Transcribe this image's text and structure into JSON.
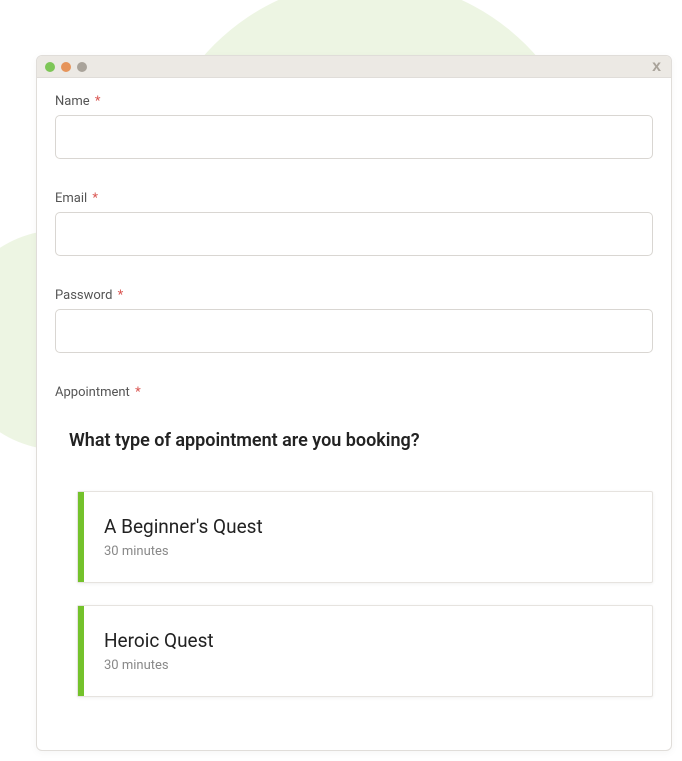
{
  "fields": {
    "name": {
      "label": "Name",
      "value": ""
    },
    "email": {
      "label": "Email",
      "value": ""
    },
    "password": {
      "label": "Password",
      "value": ""
    },
    "appointment": {
      "label": "Appointment"
    }
  },
  "required_marker": "*",
  "appointment_section": {
    "heading": "What type of appointment are you booking?",
    "options": [
      {
        "title": "A Beginner's Quest",
        "duration": "30 minutes"
      },
      {
        "title": "Heroic Quest",
        "duration": "30 minutes"
      }
    ]
  },
  "titlebar": {
    "close_label": "x"
  }
}
